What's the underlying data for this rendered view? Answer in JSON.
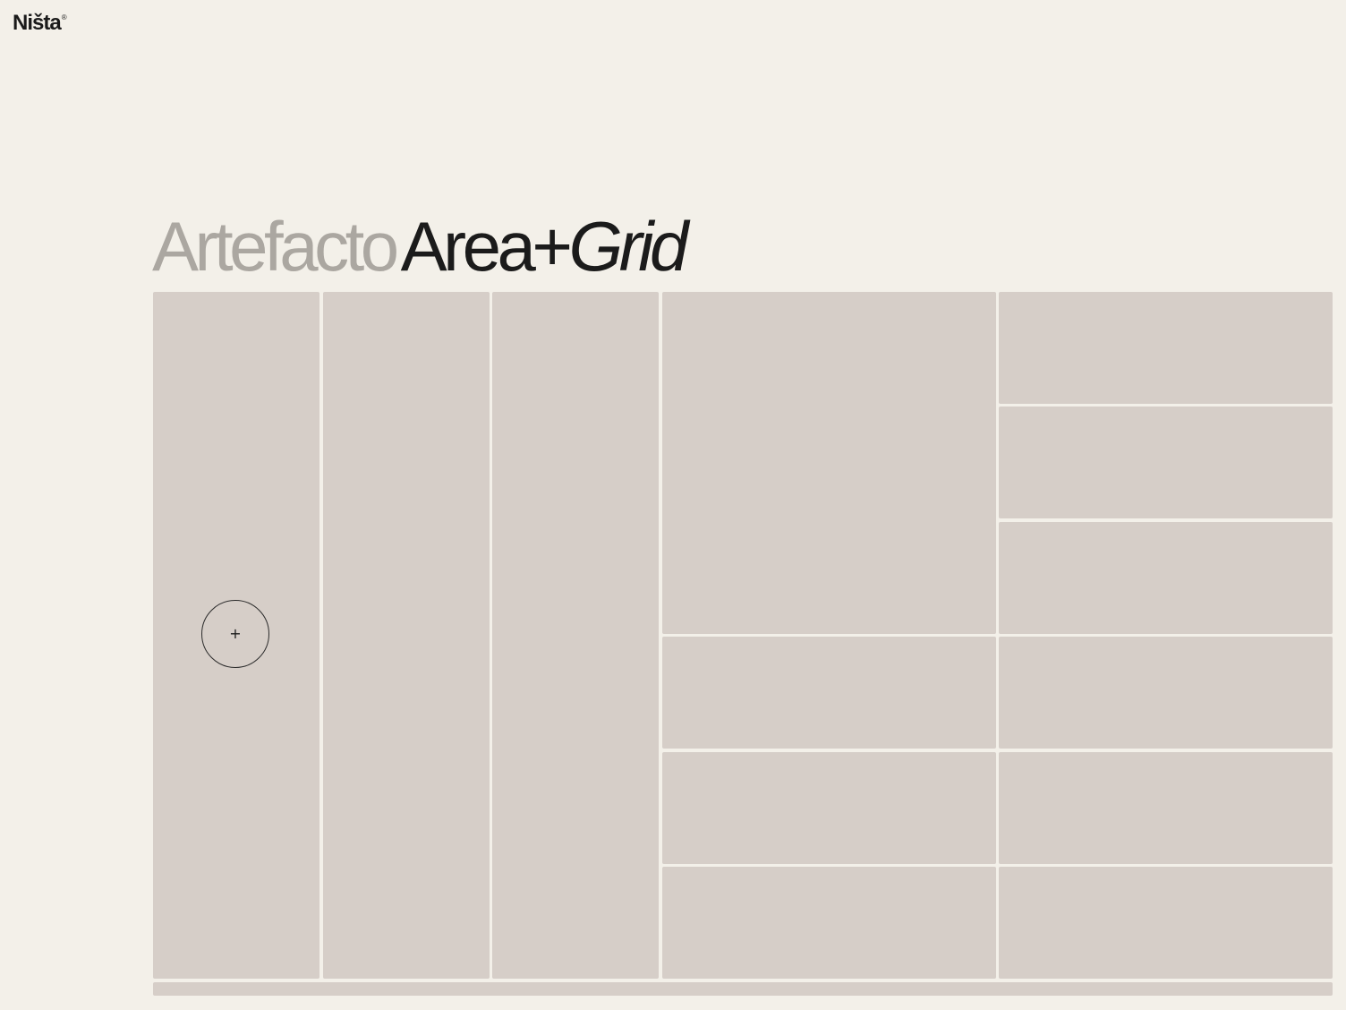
{
  "brand": {
    "name": "Ništa",
    "registered_mark": "®"
  },
  "hero": {
    "title_part_1": "Artefacto",
    "title_part_2": "Area+",
    "title_part_3": "Grid"
  },
  "cursor": {
    "icon": "plus-icon",
    "symbol": "+"
  },
  "colors": {
    "background": "#f3f0e9",
    "tile": "#d6cec8",
    "title_muted": "#aba7a1",
    "title_dark": "#1b1b1b"
  }
}
